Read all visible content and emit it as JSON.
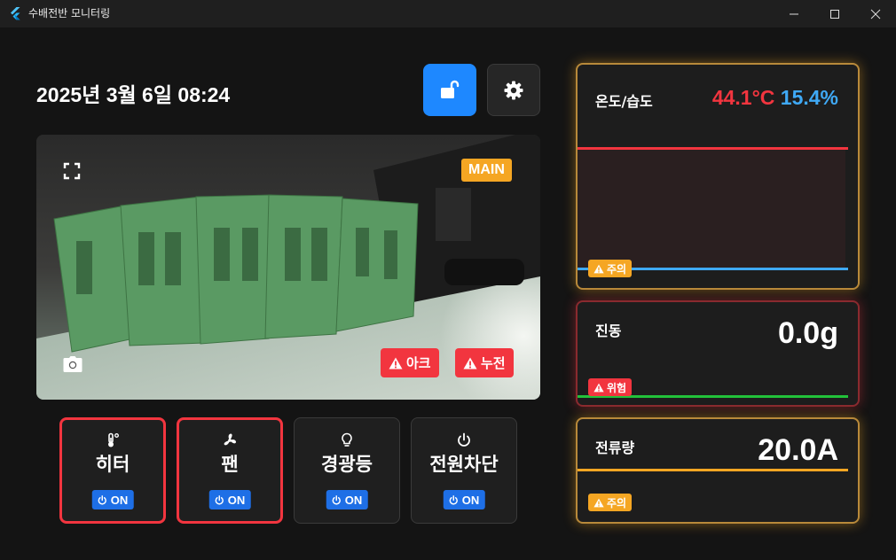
{
  "window": {
    "title": "수배전반 모니터링"
  },
  "header": {
    "datetime": "2025년 3월 6일 08:24"
  },
  "camera": {
    "label": "MAIN",
    "alerts": [
      {
        "label": "아크"
      },
      {
        "label": "누전"
      }
    ]
  },
  "controls": [
    {
      "label": "히터",
      "icon": "thermometer-icon",
      "toggle": "ON",
      "active": true
    },
    {
      "label": "팬",
      "icon": "fan-icon",
      "toggle": "ON",
      "active": true
    },
    {
      "label": "경광등",
      "icon": "lightbulb-icon",
      "toggle": "ON",
      "active": false
    },
    {
      "label": "전원차단",
      "icon": "power-icon",
      "toggle": "ON",
      "active": false
    }
  ],
  "sensors": {
    "temp_humidity": {
      "title": "온도/습도",
      "temperature": "44.1°C",
      "humidity": "15.4%",
      "status": "주의"
    },
    "vibration": {
      "title": "진동",
      "value": "0.0g",
      "status": "위험"
    },
    "current": {
      "title": "전류량",
      "value": "20.0A",
      "status": "주의"
    }
  },
  "colors": {
    "accent_blue": "#1e88ff",
    "danger_red": "#f2353f",
    "warn_orange": "#f5a623",
    "humidity_blue": "#3fa9f5",
    "vibration_green": "#22c23a",
    "toggle_blue": "#1e6fe6"
  }
}
